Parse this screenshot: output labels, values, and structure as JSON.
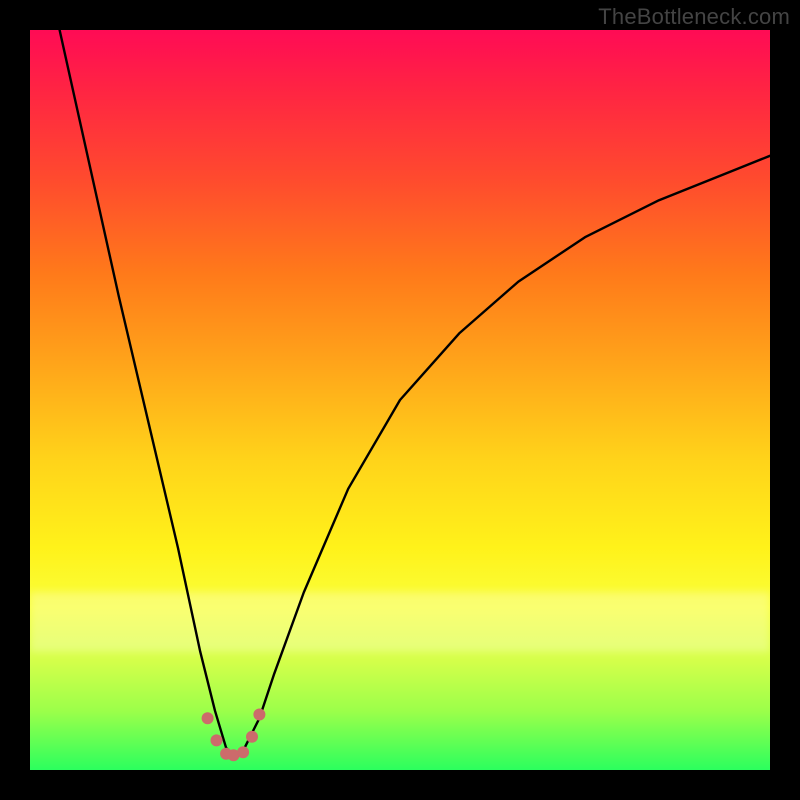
{
  "watermark": "TheBottleneck.com",
  "chart_data": {
    "type": "line",
    "title": "",
    "xlabel": "",
    "ylabel": "",
    "xlim": [
      0,
      100
    ],
    "ylim": [
      0,
      100
    ],
    "note": "Axes are unlabeled; values below are normalized 0–100 from the plot area (left/bottom = 0). Curve is a V-shape bottoming near x≈27 with a few marker dots at the trough.",
    "series": [
      {
        "name": "curve",
        "x": [
          4,
          8,
          12,
          16,
          20,
          23,
          25,
          26.5,
          27.5,
          29,
          31,
          33,
          37,
          43,
          50,
          58,
          66,
          75,
          85,
          95,
          100
        ],
        "y": [
          100,
          82,
          64,
          47,
          30,
          16,
          8,
          3,
          2,
          3,
          7,
          13,
          24,
          38,
          50,
          59,
          66,
          72,
          77,
          81,
          83
        ]
      }
    ],
    "markers": {
      "name": "trough-dots",
      "color": "#cc6b6b",
      "points": [
        {
          "x": 24.0,
          "y": 7.0
        },
        {
          "x": 25.2,
          "y": 4.0
        },
        {
          "x": 26.5,
          "y": 2.2
        },
        {
          "x": 27.5,
          "y": 2.0
        },
        {
          "x": 28.8,
          "y": 2.4
        },
        {
          "x": 30.0,
          "y": 4.5
        },
        {
          "x": 31.0,
          "y": 7.5
        }
      ]
    }
  }
}
